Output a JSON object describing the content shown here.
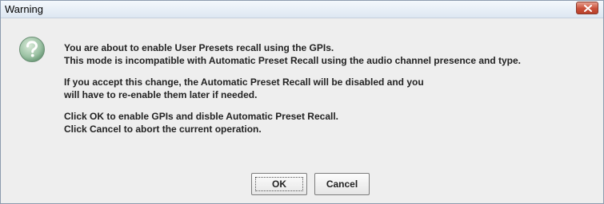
{
  "window": {
    "title": "Warning"
  },
  "icons": {
    "close": "close-icon",
    "question": "question-icon"
  },
  "message": {
    "line1": "You are about to enable User Presets recall using the GPIs.",
    "line2": "This mode is incompatible with Automatic Preset Recall using the audio channel presence and type.",
    "line3": "If you accept this change, the Automatic Preset Recall will be disabled and you",
    "line4": "will have to re-enable them later if needed.",
    "line5": "Click OK to enable GPIs and disble Automatic Preset Recall.",
    "line6": "Click Cancel to abort the current operation."
  },
  "buttons": {
    "ok_label": "OK",
    "cancel_label": "Cancel"
  },
  "colors": {
    "close_button": "#c9503a",
    "icon_fill": "#8fb89a",
    "dialog_background": "#eeeeee"
  }
}
